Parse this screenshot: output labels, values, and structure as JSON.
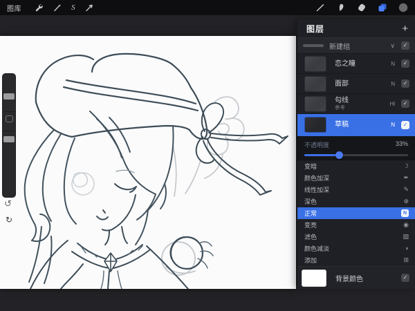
{
  "topbar": {
    "gallery_label": "图库",
    "selection_letter": "S"
  },
  "sidebar": {
    "undo_glyph": "↺",
    "redo_glyph": "↻"
  },
  "layers_panel": {
    "title": "图层",
    "add_glyph": "+",
    "chevron_down_glyph": "∨",
    "check_glyph": "✓",
    "group": {
      "name": "新建组"
    },
    "layers": [
      {
        "name": "恋之瞳",
        "blend": "N"
      },
      {
        "name": "面部",
        "blend": "N"
      },
      {
        "name": "勾线",
        "blend": "Hl",
        "sublabel": "参考"
      },
      {
        "name": "草稿",
        "blend": "N"
      }
    ],
    "opacity": {
      "label": "不透明度",
      "value": "33%"
    },
    "blend_modes": [
      {
        "label": "变暗",
        "glyph": "☽"
      },
      {
        "label": "颜色加深",
        "glyph": "✒"
      },
      {
        "label": "线性加深",
        "glyph": "✎"
      },
      {
        "label": "深色",
        "glyph": "⊕"
      },
      {
        "label": "正常",
        "glyph": "N"
      },
      {
        "label": "变亮",
        "glyph": "◉"
      },
      {
        "label": "滤色",
        "glyph": "▨"
      },
      {
        "label": "颜色减淡",
        "glyph": "◗"
      },
      {
        "label": "添加",
        "glyph": "⊞"
      }
    ],
    "background_layer": {
      "name": "背景颜色"
    }
  },
  "colors": {
    "accent_blue": "#3a70e6",
    "panel_bg": "#1f2025",
    "topbar_bg": "#0e0e10",
    "canvas_bg": "#fbfbfc",
    "sketch_stroke": "#3d4c56",
    "ghost_stroke": "#c6cacd"
  }
}
